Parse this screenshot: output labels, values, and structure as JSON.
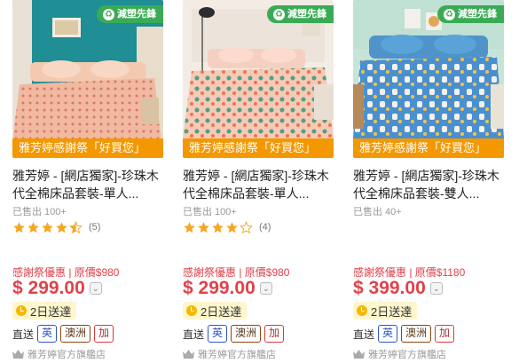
{
  "badge": {
    "eco_label": "減塑先鋒"
  },
  "products": [
    {
      "promo": "雅芳婷感謝祭「好買您」",
      "title": "雅芳婷 - [網店獨家]-珍珠木代全棉床品套裝-單人...",
      "sold": "已售出 100+",
      "rating": 4.5,
      "reviews": "(5)",
      "discount": "感謝祭優惠 | 原價$980",
      "price": "$ 299.00",
      "shipping": "2日送達",
      "direct_label": "直送",
      "tags": [
        "英",
        "澳洲",
        "加"
      ],
      "store": "雅芳婷官方旗艦店"
    },
    {
      "promo": "雅芳婷感謝祭「好買您」",
      "title": "雅芳婷 - [網店獨家]-珍珠木代全棉床品套裝-單人...",
      "sold": "已售出 100+",
      "rating": 4,
      "reviews": "(4)",
      "discount": "感謝祭優惠 | 原價$980",
      "price": "$ 299.00",
      "shipping": "2日送達",
      "direct_label": "直送",
      "tags": [
        "英",
        "澳洲",
        "加"
      ],
      "store": "雅芳婷官方旗艦店"
    },
    {
      "promo": "雅芳婷感謝祭「好買您」",
      "title": "雅芳婷 - [網店獨家]-珍珠木代全棉床品套裝-雙人...",
      "sold": "已售出 40+",
      "rating": null,
      "reviews": "",
      "discount": "感謝祭優惠 | 原價$1180",
      "price": "$ 399.00",
      "shipping": "2日送達",
      "direct_label": "直送",
      "tags": [
        "英",
        "澳洲",
        "加"
      ],
      "store": "雅芳婷官方旗艦店"
    }
  ],
  "colors": {
    "price": "#e0424a",
    "promo": "#f39800",
    "eco": "#3aab55",
    "star": "#f5a623"
  }
}
